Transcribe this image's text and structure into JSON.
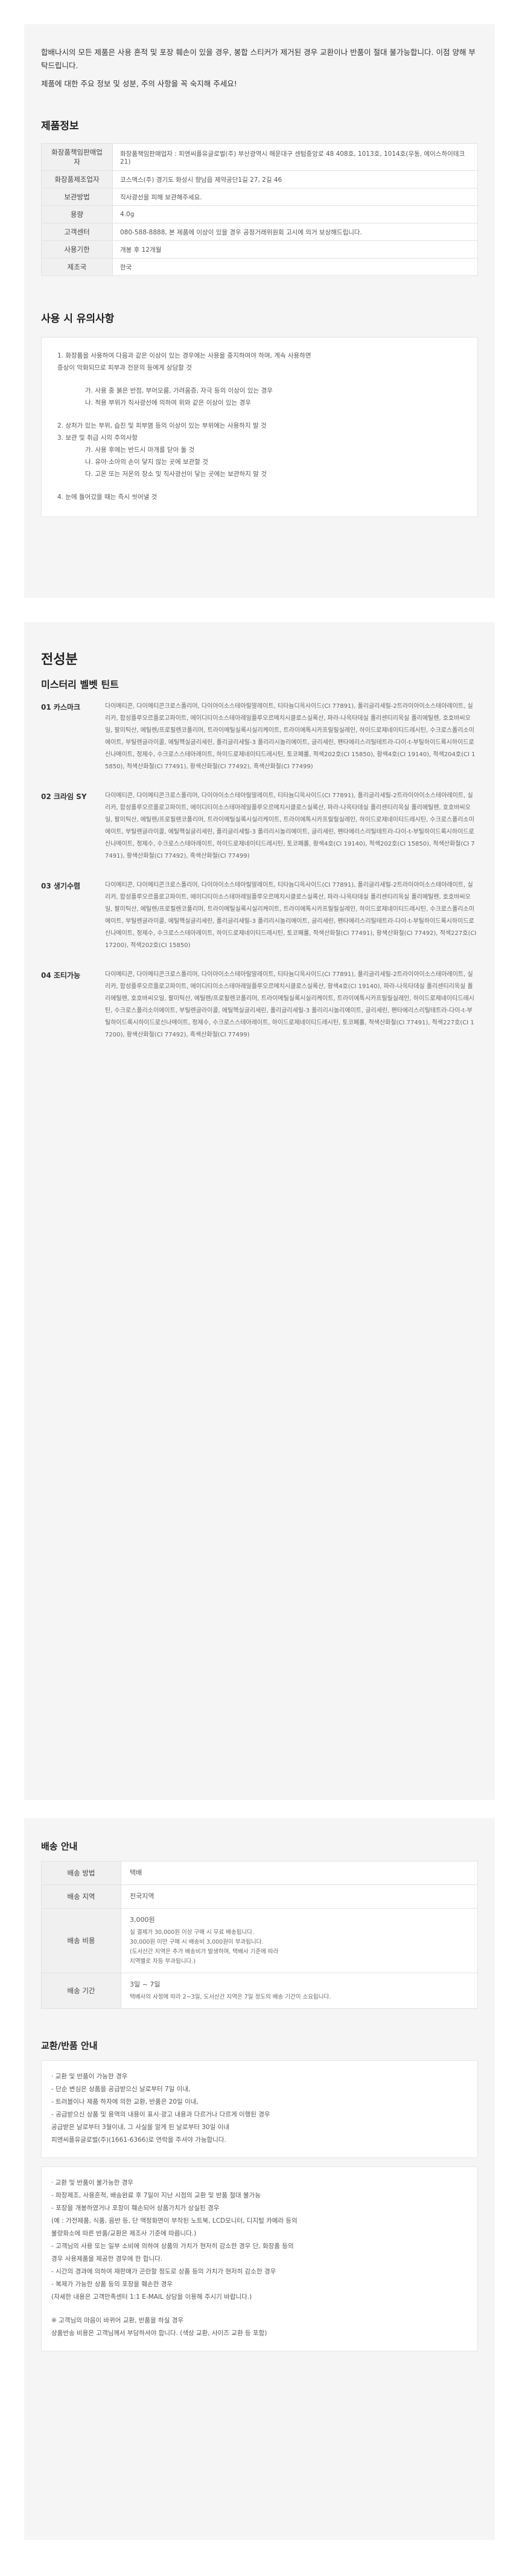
{
  "notice": [
    "합배나시의 모든 제품은 사용 흔적 및 포장 훼손이 있을 경우, 봉합 스티커가 제거된 경우 교환이나 반품이 절대 불가능합니다. 이점 양해 부탁드립니다.",
    "제품에 대한 주요 정보 및 성분, 주의 사항을 꼭 숙지해 주세요!"
  ],
  "product_info": {
    "title": "제품정보",
    "rows": [
      {
        "k": "화장품책임판매업자",
        "v": "화장품책임판매업자 : 피엔씨플유글로벌(주) 부산광역시 해운대구 센텀중앙로 48 408호, 1013호, 1014호(우동, 에이스하이테크21)"
      },
      {
        "k": "화장품제조업자",
        "v": "코스맥스(주) 경기도 화성시 향남읍 제약공단1길 27, 2길 46"
      },
      {
        "k": "보관방법",
        "v": "직사광선을 피해 보관해주세요."
      },
      {
        "k": "용량",
        "v": "4.0g"
      },
      {
        "k": "고객센터",
        "v": "080-588-8888, 본 제품에 이상이 있을 경우 공정거래위원회 고시에 의거 보상해드립니다."
      },
      {
        "k": "사용기한",
        "v": "개봉 후 12개월"
      },
      {
        "k": "제조국",
        "v": "한국"
      }
    ]
  },
  "caution": {
    "title": "사용 시 유의사항",
    "items": [
      {
        "t": "1.  화장품을 사용하여 다음과 같은 이상이 있는 경우에는 사용을 중지하여야 하며, 계속 사용하면",
        "gap": false
      },
      {
        "t": "     증상이 악화되므로 피부과 전문의 등에게 상담할 것",
        "gap": false
      },
      {
        "t": "가. 사용 중 붉은 반점, 부어오름, 가려움증, 자극 등의 이상이 있는 경우",
        "sub": true,
        "gap": true
      },
      {
        "t": "나. 적용 부위가 직사광선에 의하여 위와 같은 이상이 있는 경우",
        "sub": true,
        "gap": false
      },
      {
        "t": "2.  상처가 있는 부위, 습진 및 피부염 등의 이상이 있는 부위에는 사용하지 말 것",
        "gap": true
      },
      {
        "t": "3.  보관 및 취급 시의 주의사항",
        "gap": false
      },
      {
        "t": "가. 사용 후에는 반드시 마개를 닫아 둘 것",
        "sub": true,
        "gap": false
      },
      {
        "t": "나. 유아·소아의 손이 닿지 않는 곳에 보관할 것",
        "sub": true,
        "gap": false
      },
      {
        "t": "다. 고온 또는 저온의 장소 및 직사광선이 닿는 곳에는 보관하지 말 것",
        "sub": true,
        "gap": false
      },
      {
        "t": "4.  눈에 들어갔을 때는 즉시 씻어낼 것",
        "gap": true
      }
    ]
  },
  "ingredients": {
    "title": "전성분",
    "subtitle": "미스터리 벨벳 틴트",
    "shades": [
      {
        "name": "01 카스마크",
        "text": "다이메티콘, 다이메티콘크로스폴리머, 다이아이소스테아릴말레이트, 티타늄디옥사이드(CI 77891), 폴리글리세릴-2트라이아이소스테아레이트, 실리카, 합성플루오르플로고파이트, 에이디티이소스테아레일플루오르메치시클로스실록산, 파라-나옥타데실 폴리센티리옥실 폴리에틸렌, 호호바씨오일, 팔미틱산, 에틸렌/프로필렌코폴리머, 트라이메틸실록시실리케이트, 트라이에톡시카프릴릴실레인, 하이드로제네이티드레시틴, 수크로스폴리소이에이트, 부틸렌글라이콜, 에틸헥실글리세린, 폴리글리세릴-3 폴리리시놀리에이트, 글리세린, 펜타에리스리틸테트라-다이-t-부틸하이드록시하이드로신나메이트, 정제수, 수크로스스테아레이트, 하이드로제네이티드레시틴, 토코페롤, 적색202호(CI 15850), 황색4호(CI 19140), 적색204호(CI 15850), 적색산화철(CI 77491), 황색산화철(CI 77492), 흑색산화철(CI 77499)"
      },
      {
        "name": "02 크라임 SY",
        "text": "다이메티콘, 다이메티콘크로스폴리머, 다이아이소스테아릴말레이트, 티타늄디옥사이드(CI 77891), 폴리글리세릴-2트라이아이소스테아레이트, 실리카, 합성플루오르플로고파이트, 에이디티이소스테아레일플루오르메치시클로스실록산, 파라-나옥타데실 폴리센티리옥실 폴리에틸렌, 호호바씨오일, 팔미틱산, 에틸렌/프로필렌코폴리머, 트라이메틸실록시실리케이트, 트라이에톡시카프릴릴실레인, 하이드로제네이티드레시틴, 수크로스폴리소이에이트, 부틸렌글라이콜, 에틸헥실글리세린, 폴리글리세릴-3 폴리리시놀리에이트, 글리세린, 펜타에리스리틸테트라-다이-t-부틸하이드록시하이드로신나메이트, 정제수, 수크로스스테아레이트, 하이드로제네이티드레시틴, 토코페롤, 황색4호(CI 19140), 적색202호(CI 15850), 적색산화철(CI 77491), 황색산화철(CI 77492), 흑색산화철(CI 77499)"
      },
      {
        "name": "03 생기수렴",
        "text": "다이메티콘, 다이메티콘크로스폴리머, 다이아이소스테아릴말레이트, 티타늄디옥사이드(CI 77891), 폴리글리세릴-2트라이아이소스테아레이트, 실리카, 합성플루오르플로고파이트, 에이디티이소스테아레일플루오르메치시클로스실록산, 파라-나옥타데실 폴리센티리옥실 폴리에틸렌, 호호바씨오일, 팔미틱산, 에틸렌/프로필렌코폴리머, 트라이메틸실록시실리케이트, 트라이에톡시카프릴릴실레인, 하이드로제네이티드레시틴, 수크로스폴리소이에이트, 부틸렌글라이콜, 에틸헥실글리세린, 폴리글리세릴-3 폴리리시놀리에이트, 글리세린, 펜타에리스리틸테트라-다이-t-부틸하이드록시하이드로신나메이트, 정제수, 수크로스스테아레이트, 하이드로제네이티드레시틴, 토코페롤, 적색산화철(CI 77491), 황색산화철(CI 77492), 적색227호(CI 17200), 적색202호(CI 15850)"
      },
      {
        "name": "04 조티가능",
        "text": "다이메티콘, 다이메티콘크로스폴리머, 다이아이소스테아릴말레이트, 티타늄디옥사이드(CI 77891), 폴리글리세릴-2트라이아이소스테아레이트, 실리카, 합성플루오르플로고파이트, 에이디티이소스테아레일플루오르메치시클로스실록산, 황색4호(CI 19140), 파라-나옥타데실 폴리센티리옥실 폴리에틸렌, 호호바씨오일, 팔미틱산, 에틸렌/프로필렌코폴리머, 트라이메틸실록시실리케이트, 트라이에톡시카프릴릴실레인, 하이드로제네이티드레시틴, 수크로스폴리소이에이트, 부틸렌글라이콜, 에틸헥실글리세린, 폴리글리세릴-3 폴리리시놀리에이트, 글리세린, 펜타에리스리틸테트라-다이-t-부틸하이드록시하이드로신나메이트, 정제수, 수크로스스테아레이트, 하이드로제네이티드레시틴, 토코페롤, 적색산화철(CI 77491), 적색227호(CI 17200), 황색산화철(CI 77492), 흑색산화철(CI 77499)"
      }
    ]
  },
  "shipping": {
    "title": "배송 안내",
    "rows": [
      {
        "k": "배송 방법",
        "v": [
          "택배"
        ]
      },
      {
        "k": "배송 지역",
        "v": [
          "전국지역"
        ]
      },
      {
        "k": "배송 비용",
        "v": [
          "3,000원",
          "실 결제가 30,000원 이상 구매 시 무료 배송됩니다.",
          "30,000원 이만 구매 시 배송비 3,000원이 부과됩니다.",
          "(도서산간 지역은 추가 배송비가 발생하며, 택배사 기준에 따라",
          "지역별로 차등 부과됩니다.)"
        ]
      },
      {
        "k": "배송 기간",
        "v": [
          "3일 ~ 7일",
          "택배사의 사정에 따라 2~3일, 도서산간 지역은 7일 정도의 배송 기간이 소요됩니다."
        ]
      }
    ]
  },
  "exchange": {
    "title": "교환/반품 안내",
    "possible": [
      "· 교환 및 반품이 가능한 경우",
      "- 단순 변심은 상품을 공급받으신 날로부터 7일 이내,",
      "- 트러블이나 제품 하자에 의한 교환, 반품은 20일 이내,",
      "- 공급받으신 상품 및 용역의 내용이 표시·광고 내용과 다르거나 다르게 이행된 경우",
      "  공급받은 날로부터 3월이내, 그 사실을 알게 된 날로부터 30일 이내",
      "  피엔씨플유글로벌(주)(1661-6366)로 연락을 주셔야 가능합니다."
    ],
    "impossible": [
      "· 교환 및 반품이 불가능한 경우",
      "- 파장제조, 사용흔적, 배송완료 후 7일이 지난 시점의 교환 및 반품 절대 불가능",
      "- 포장을 개봉하였거나 포장이 훼손되어 상품가치가 상실된 경우",
      "  (예 : 가전제품, 식품, 음반 등, 단 액정화면이 부착된 노트북, LCD모니터, 디지털 카메라 등의",
      "  불량화소에 따른 반품/교환은 제조사 기준에 따릅니다.)",
      "- 고객님의 사용 또는 일부 소비에 의하여 상품의 가치가 현저히 감소한 경우 단, 화장품 등의",
      "  경우 사용제품을 제공한 경우에 한 합니다.",
      "- 시간의 경과에 의하여 재판매가 곤란할 정도로 상품 등의 가치가 현저히 감소한 경우",
      "- 복제가 가능한 상품 등의 포장을 훼손한 경우",
      "  (자세한 내용은 고객만족센터 1:1 E-MAIL 상담을 이용해 주시기 바랍니다.)"
    ],
    "note": [
      "※ 고객님의 마음이 바뀌어 교환, 반품을 하실 경우",
      "상품반송 비용은 고객님께서 부담하셔야 합니다. (색상 교환, 사이즈 교환 등 포함)"
    ]
  }
}
